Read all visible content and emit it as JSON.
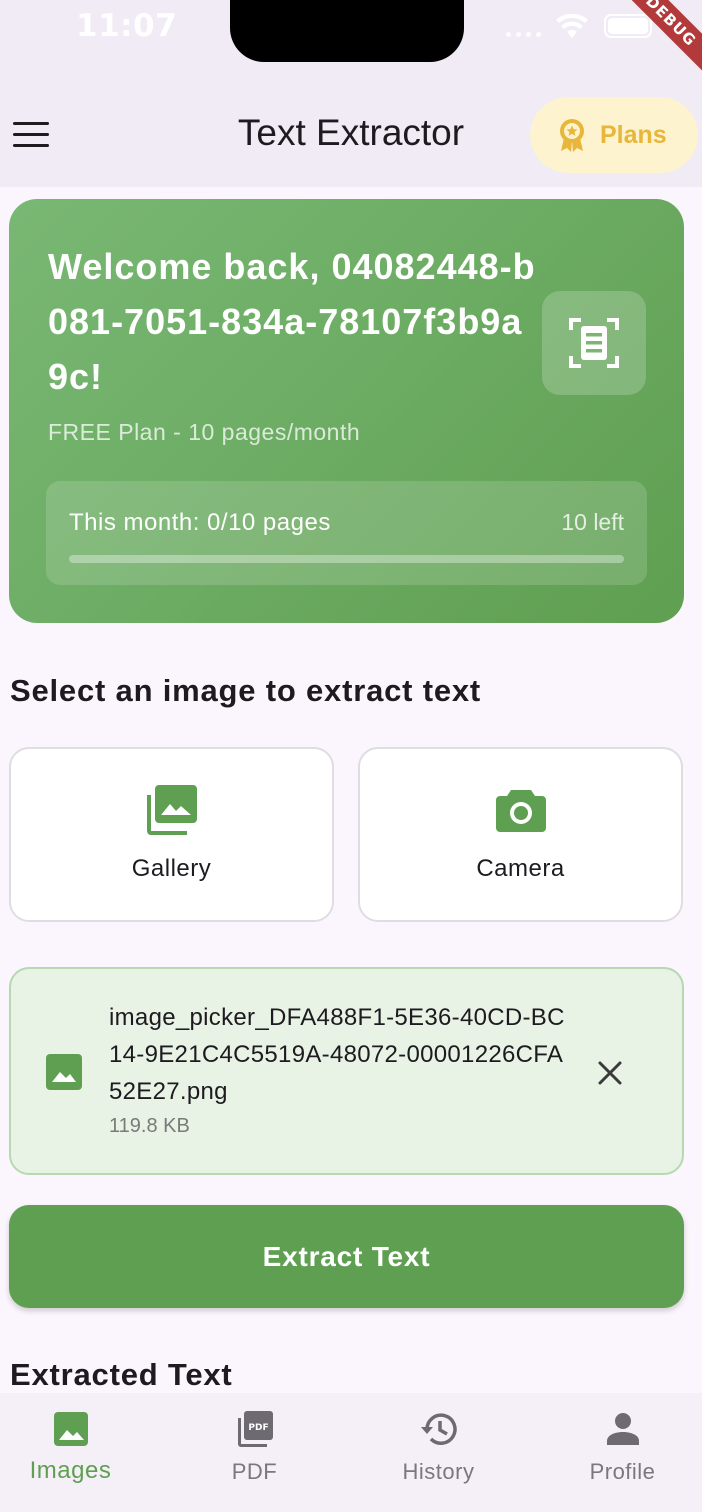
{
  "status_bar": {
    "time": "11:07",
    "debug_label": "DEBUG"
  },
  "app_bar": {
    "title": "Text Extractor",
    "menu_icon": "menu-icon",
    "plans_label": "Plans",
    "plans_icon": "award-badge-icon"
  },
  "welcome": {
    "title": "Welcome back, 04082448-b081-7051-834a-78107f3b9a9c!",
    "plan_info": "FREE Plan - 10 pages/month",
    "usage_text": "This month: 0/10 pages",
    "usage_left": "10 left",
    "usage_used": 0,
    "usage_total": 10,
    "badge_icon": "document-scan-icon"
  },
  "select_section": {
    "title": "Select an image to extract text",
    "sources": [
      {
        "label": "Gallery",
        "icon": "gallery-icon"
      },
      {
        "label": "Camera",
        "icon": "camera-icon"
      }
    ]
  },
  "selected_file": {
    "name": "image_picker_DFA488F1-5E36-40CD-BC14-9E21C4C5519A-48072-00001226CFA52E27.png",
    "size": "119.8 KB",
    "icon": "image-icon"
  },
  "extract_button": {
    "label": "Extract Text"
  },
  "extracted_section": {
    "title": "Extracted Text"
  },
  "bottom_nav": {
    "items": [
      {
        "label": "Images",
        "icon": "image-icon",
        "active": true
      },
      {
        "label": "PDF",
        "icon": "pdf-icon",
        "active": false
      },
      {
        "label": "History",
        "icon": "history-icon",
        "active": false
      },
      {
        "label": "Profile",
        "icon": "person-icon",
        "active": false
      }
    ]
  },
  "colors": {
    "primary_green": "#5f9f51",
    "plans_bg": "#fdf3cf",
    "plans_text": "#e7b63a",
    "file_card_bg": "#e8f2e5"
  }
}
